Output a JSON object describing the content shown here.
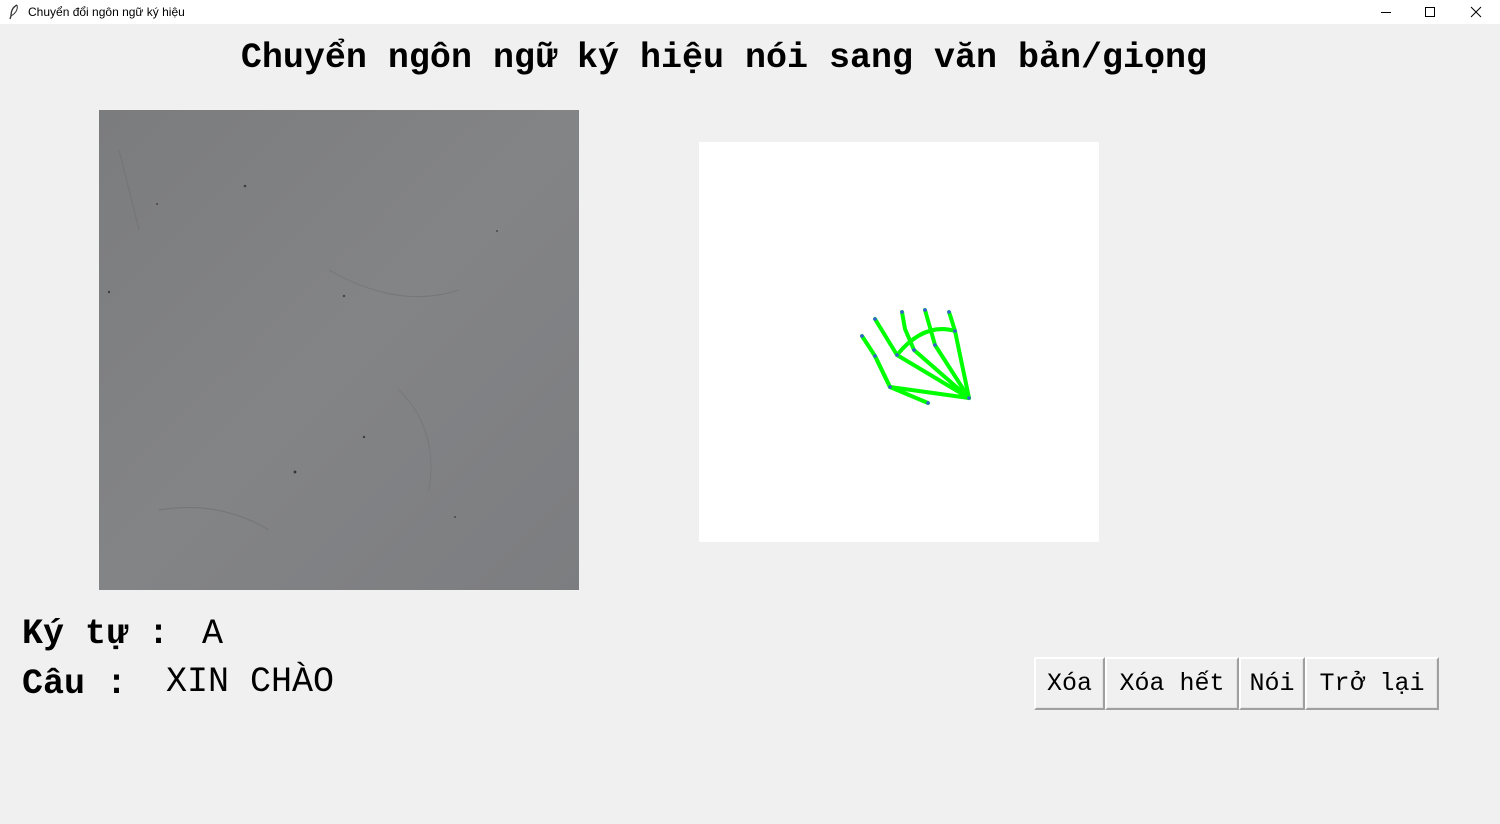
{
  "window": {
    "title": "Chuyển đổi ngôn ngữ ký hiệu"
  },
  "heading": "Chuyển ngôn ngữ ký hiệu nói sang văn bản/giọng",
  "recognition": {
    "character_label": "Ký tự :",
    "character_value": "A",
    "sentence_label": "Câu :",
    "sentence_value": "XIN CHÀO"
  },
  "buttons": {
    "delete": "Xóa",
    "delete_all": "Xóa hết",
    "speak": "Nói",
    "back": "Trở lại"
  },
  "colors": {
    "background": "#f0f0f0",
    "camera_feed": "#7d7e80",
    "hand_skeleton": "#00ff00",
    "landmark": "#3a5bd9"
  },
  "icons": {
    "app": "feather-icon",
    "minimize": "minimize-icon",
    "maximize": "maximize-icon",
    "close": "close-icon"
  }
}
